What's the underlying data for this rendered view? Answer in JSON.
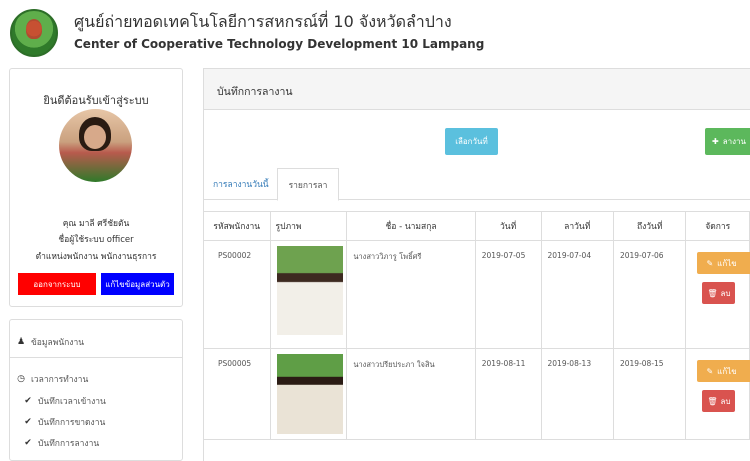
{
  "header": {
    "title_th": "ศูนย์ถ่ายทอดเทคโนโลยีการสหกรณ์ที่ 10 จังหวัดลำปาง",
    "title_en": "Center of Cooperative Technology Development 10 Lampang"
  },
  "profile": {
    "welcome": "ยินดีต้อนรับเข้าสู่ระบบ",
    "name": "คุณ มาลี ศรีชัยตัน",
    "username_line": "ชื่อผู้ใช้ระบบ officer",
    "position_line": "ตำแหน่งพนักงาน พนักงานธุรการ",
    "logout_label": "ออกจากระบบ",
    "edit_profile_label": "แก้ไขข้อมูลส่วนตัว"
  },
  "menu": {
    "employee_info": "ข้อมูลพนักงาน",
    "working_time": "เวลาการทำงาน",
    "items": [
      "บันทึกเวลาเข้างาน",
      "บันทึกการขาดงาน",
      "บันทึกการลางาน"
    ]
  },
  "panel": {
    "title": "บันทึกการลางาน",
    "select_date_label": "เลือกวันที่",
    "add_label": "ลางาน"
  },
  "tabs": [
    "การลางานวันนี้",
    "รายการลา"
  ],
  "table": {
    "headers": [
      "รหัสพนักงาน",
      "รูปภาพ",
      "ชื่อ - นามสกุล",
      "วันที่",
      "ลาวันที่",
      "ถึงวันที่",
      "จัดการ"
    ],
    "rows": [
      {
        "id": "PS00002",
        "name": "นางสาววิภารู โพธิ์ศรี",
        "date": "2019-07-05",
        "from": "2019-07-04",
        "to": "2019-07-06"
      },
      {
        "id": "PS00005",
        "name": "นางสาวปรียประภา ใจสิน",
        "date": "2019-08-11",
        "from": "2019-08-13",
        "to": "2019-08-15"
      }
    ],
    "edit_label": "แก้ไข",
    "delete_label": "ลบ"
  },
  "colors": {
    "logout": "#ff0000",
    "edit_profile": "#0000ff",
    "info_button": "#5bc0de",
    "success_button": "#5cb85c",
    "warning_button": "#f0ad4e",
    "danger_button": "#d9534f"
  }
}
